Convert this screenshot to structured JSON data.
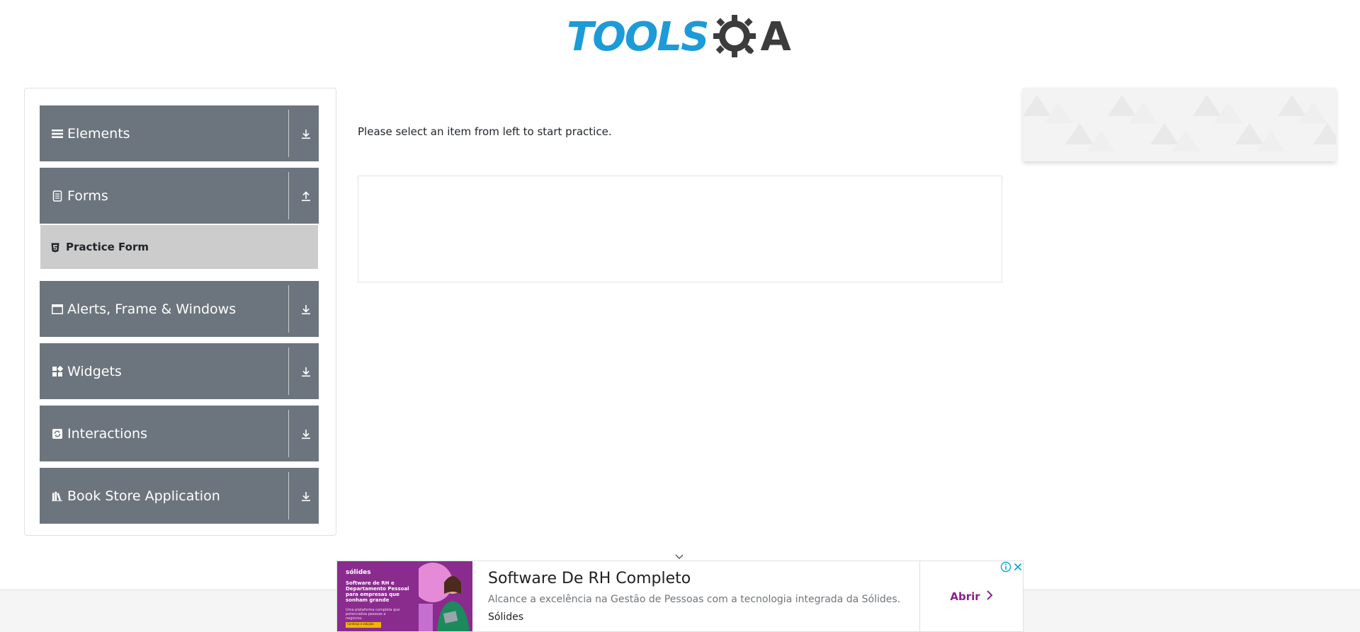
{
  "header": {
    "logo_text_tools": "TOOLS",
    "logo_text_a": "A",
    "logo_colors": {
      "tools": "#1d9bd8",
      "qa": "#3c3c3c"
    }
  },
  "sidebar": {
    "groups": [
      {
        "label": "Elements",
        "icon": "list-icon",
        "toggle": "download-icon"
      },
      {
        "label": "Forms",
        "icon": "form-icon",
        "toggle": "upload-icon"
      },
      {
        "label": "Alerts, Frame & Windows",
        "icon": "window-icon",
        "toggle": "download-icon"
      },
      {
        "label": "Widgets",
        "icon": "widgets-icon",
        "toggle": "download-icon"
      },
      {
        "label": "Interactions",
        "icon": "interactions-icon",
        "toggle": "download-icon"
      },
      {
        "label": "Book Store Application",
        "icon": "books-icon",
        "toggle": "download-icon"
      }
    ],
    "forms_items": [
      {
        "label": "Practice Form",
        "icon": "html5-icon"
      }
    ],
    "colors": {
      "group_bg": "#6c757d",
      "sub_item_bg": "#cccccc"
    }
  },
  "main": {
    "instruction": "Please select an item from left to start practice."
  },
  "ad": {
    "title": "Software De RH Completo",
    "description": "Alcance a excelência na Gestão de Pessoas com a tecnologia integrada da Sólides.",
    "source": "Sólides",
    "cta": "Abrir",
    "image_brand": "sólides",
    "image_headline": "Software de RH e Departamento Pessoal para empresas que sonham grande",
    "image_sub": "Uma plataforma completa que potencializa pessoas e negócios.",
    "image_tag": "Conheça a solução",
    "accent_color": "#8c1d8f"
  }
}
